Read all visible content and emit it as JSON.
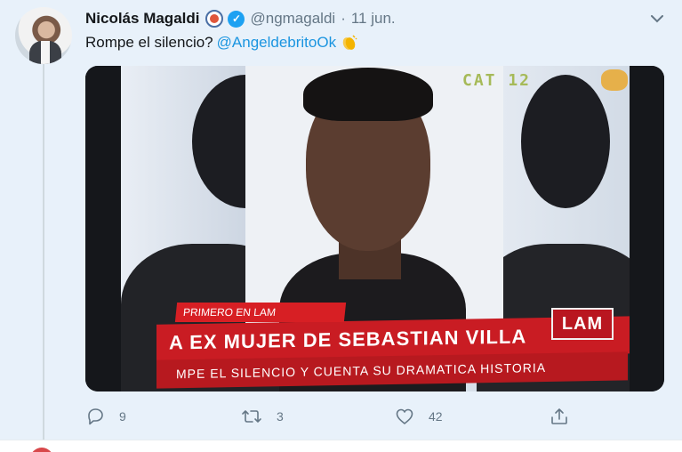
{
  "tweet": {
    "author_name": "Nicolás Magaldi",
    "handle": "@ngmagaldi",
    "separator": "·",
    "date": "11 jun.",
    "text": "Rompe el silencio?",
    "mention": "@AngeldebritoOk",
    "icons": [
      "emoji-badge-icon",
      "verified-badge-icon",
      "chevron-down-icon",
      "clapping-hands-icon"
    ],
    "colors": {
      "background": "#e8f1fa",
      "link": "#1b95e0",
      "muted": "#657786",
      "verified": "#1da1f2"
    }
  },
  "media": {
    "channel_logo": "CAT 12",
    "banner_tag": "PRIMERO EN LAM",
    "banner_headline": "A EX MUJER DE SEBASTIAN VILLA",
    "banner_subline": "MPE EL SILENCIO Y CUENTA SU DRAMATICA HISTORIA",
    "banner_logo": "LAM",
    "banner_color": "#c91c23"
  },
  "actions": {
    "reply_count": "9",
    "retweet_count": "3",
    "like_count": "42",
    "icons": [
      "reply-icon",
      "retweet-icon",
      "like-icon",
      "share-icon"
    ]
  }
}
